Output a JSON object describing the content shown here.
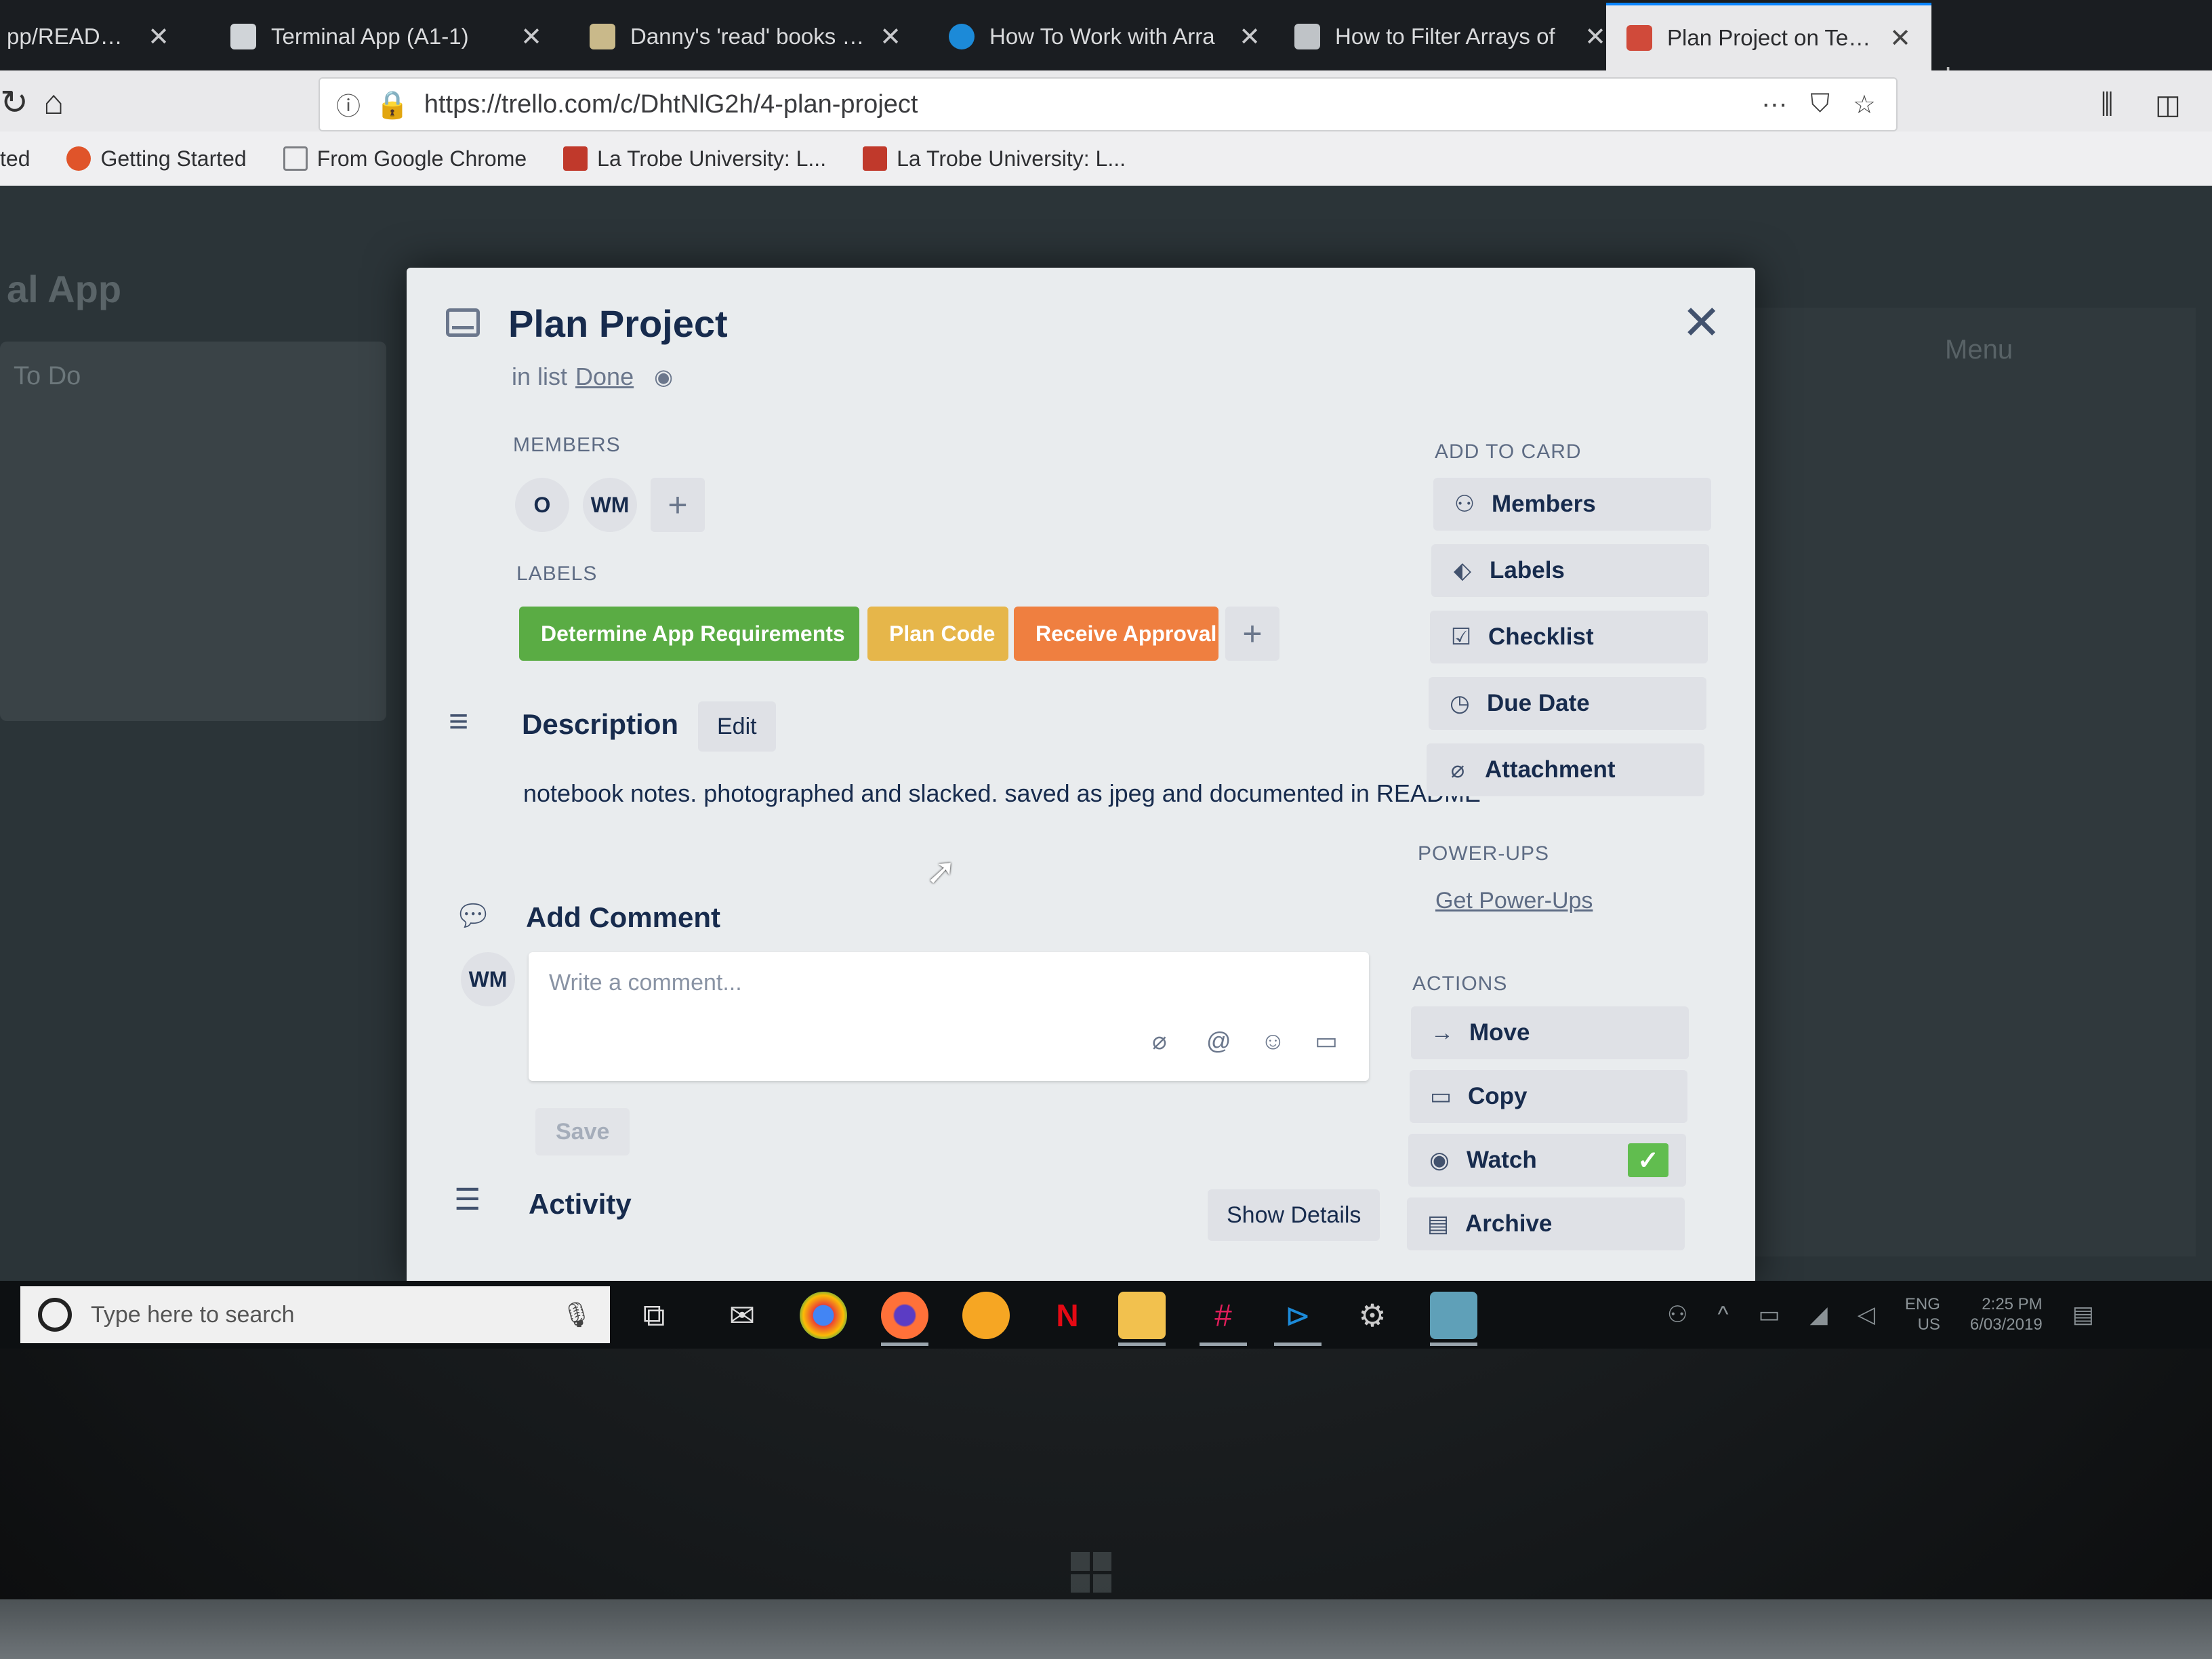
{
  "browser": {
    "tabs": [
      {
        "title": "pp/README",
        "favicon_color": "#2e2f32"
      },
      {
        "title": "Terminal App (A1-1)",
        "favicon_color": "#d0d4d8"
      },
      {
        "title": "Danny's 'read' books on",
        "favicon_color": "#c9b98a"
      },
      {
        "title": "How To Work with Arra",
        "favicon_color": "#1c8ad8"
      },
      {
        "title": "How to Filter Arrays of",
        "favicon_color": "#bfc3c7"
      },
      {
        "title": "Plan Project on Terminal",
        "favicon_color": "#d04a3a"
      }
    ],
    "url": "https://trello.com/c/DhtNlG2h/4-plan-project",
    "bookmarks": [
      {
        "label": "ted",
        "color": "#00000000"
      },
      {
        "label": "Getting Started",
        "color": "#e0542a"
      },
      {
        "label": "From Google Chrome",
        "color": "#7d7f84"
      },
      {
        "label": "La Trobe University: L...",
        "color": "#c0392b"
      },
      {
        "label": "La Trobe University: L...",
        "color": "#c0392b"
      }
    ]
  },
  "board": {
    "title": "al App",
    "list_title": "To Do",
    "menu_title": "Menu"
  },
  "card": {
    "title": "Plan Project",
    "in_list_prefix": "in list",
    "list_name": "Done",
    "members_heading": "MEMBERS",
    "members": [
      "O",
      "WM"
    ],
    "labels_heading": "LABELS",
    "labels": [
      {
        "text": "Determine App Requirements",
        "color": "#5aac44"
      },
      {
        "text": "Plan Code",
        "color": "#e6b64a"
      },
      {
        "text": "Receive Approval",
        "color": "#ef7f40"
      }
    ],
    "description_heading": "Description",
    "edit_label": "Edit",
    "description": "notebook notes. photographed and slacked. saved as jpeg and documented in README",
    "add_comment_heading": "Add Comment",
    "comment_avatar": "WM",
    "comment_placeholder": "Write a comment...",
    "save_label": "Save",
    "activity_heading": "Activity",
    "show_details_label": "Show Details"
  },
  "sidebar": {
    "add_to_card_heading": "ADD TO CARD",
    "add_to_card": [
      {
        "label": "Members",
        "icon": "person-icon"
      },
      {
        "label": "Labels",
        "icon": "tag-icon"
      },
      {
        "label": "Checklist",
        "icon": "checkbox-icon"
      },
      {
        "label": "Due Date",
        "icon": "clock-icon"
      },
      {
        "label": "Attachment",
        "icon": "paperclip-icon"
      }
    ],
    "powerups_heading": "POWER-UPS",
    "get_powerups_label": "Get Power-Ups",
    "actions_heading": "ACTIONS",
    "actions": [
      {
        "label": "Move",
        "icon": "arrow-right-icon"
      },
      {
        "label": "Copy",
        "icon": "card-icon"
      },
      {
        "label": "Watch",
        "icon": "eye-icon",
        "checked": true
      },
      {
        "label": "Archive",
        "icon": "archive-icon"
      }
    ]
  },
  "taskbar": {
    "search_placeholder": "Type here to search",
    "lang_top": "ENG",
    "lang_bottom": "US",
    "time": "2:25 PM",
    "date": "6/03/2019"
  }
}
